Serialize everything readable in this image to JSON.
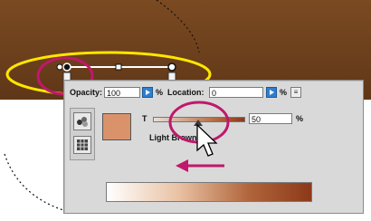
{
  "gradient_panel": {
    "opacity_label": "Opacity:",
    "opacity_value": "100",
    "opacity_unit": "%",
    "location_label": "Location:",
    "location_value": "0",
    "location_unit": "%",
    "tint_label": "T",
    "tint_value": "50",
    "tint_unit": "%",
    "color_name": "Light Brown"
  },
  "colors": {
    "canvas_brown": "#6b3f1c",
    "swatch_light_brown": "#d9926a",
    "highlight_magenta": "#c0186c",
    "selection_yellow": "#ffe600",
    "stepper_blue": "#2d7fd0"
  },
  "slider": {
    "tint_fraction": 0.5
  },
  "icons": [
    "color-swatches-icon",
    "grid-icon",
    "panel-menu-icon",
    "mouse-pointer-icon",
    "left-arrow-icon"
  ]
}
